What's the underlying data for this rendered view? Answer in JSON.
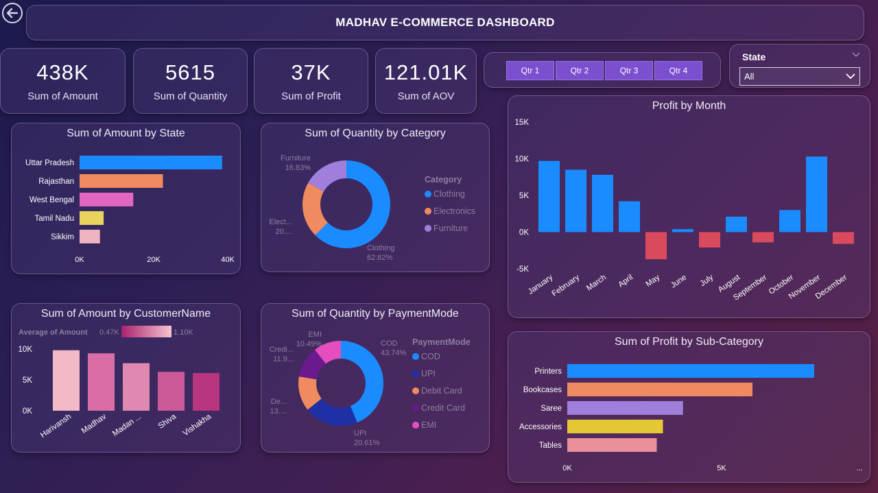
{
  "header": {
    "title": "MADHAV E-COMMERCE DASHBOARD"
  },
  "kpis": [
    {
      "value": "438K",
      "label": "Sum of Amount"
    },
    {
      "value": "5615",
      "label": "Sum of Quantity"
    },
    {
      "value": "37K",
      "label": "Sum of Profit"
    },
    {
      "value": "121.01K",
      "label": "Sum of AOV"
    }
  ],
  "quarters": [
    "Qtr 1",
    "Qtr 2",
    "Qtr 3",
    "Qtr 4"
  ],
  "state_slicer": {
    "label": "State",
    "value": "All"
  },
  "colors": {
    "blue": "#1a8cff",
    "orange": "#ef8b5e",
    "pink": "#e066c2",
    "yellow": "#e8d45c",
    "lightpink": "#f0b3c2",
    "negative": "#d94a5c",
    "purple": "#9f7fdb",
    "navy": "#1f30a6",
    "darkpurple": "#6a1a8c",
    "magenta": "#e64dbf"
  },
  "chart_data": [
    {
      "id": "amount_by_state",
      "type": "bar",
      "orientation": "horizontal",
      "title": "Sum of Amount by State",
      "categories": [
        "Uttar Pradesh",
        "Rajasthan",
        "West Bengal",
        "Tamil Nadu",
        "Sikkim"
      ],
      "values": [
        38500,
        22500,
        14500,
        6500,
        5500
      ],
      "xlim": [
        0,
        40000
      ],
      "ticks": [
        0,
        20000,
        40000
      ],
      "tick_labels": [
        "0K",
        "20K",
        "40K"
      ]
    },
    {
      "id": "quantity_by_category",
      "type": "pie",
      "donut": true,
      "title": "Sum of Quantity by Category",
      "legend_title": "Category",
      "slices": [
        {
          "label": "Clothing",
          "value": 62.62,
          "pct_label": "62.62%"
        },
        {
          "label": "Electronics",
          "value": 20.55,
          "pct_label": "20...."
        },
        {
          "label": "Furniture",
          "value": 16.83,
          "pct_label": "16.83%"
        }
      ],
      "callout_labels": [
        "Clothing",
        "Elect...",
        "Furniture"
      ]
    },
    {
      "id": "profit_by_month",
      "type": "bar",
      "title": "Profit by Month",
      "categories": [
        "January",
        "February",
        "March",
        "April",
        "May",
        "June",
        "July",
        "August",
        "September",
        "October",
        "November",
        "December"
      ],
      "values": [
        9700,
        8500,
        7800,
        4200,
        -3700,
        400,
        -2100,
        2100,
        -1400,
        3000,
        10300,
        -1600
      ],
      "ylim": [
        -5000,
        15000
      ],
      "ticks": [
        -5000,
        0,
        5000,
        10000,
        15000
      ],
      "tick_labels": [
        "-5K",
        "0K",
        "5K",
        "10K",
        "15K"
      ]
    },
    {
      "id": "amount_by_customer",
      "type": "bar",
      "title": "Sum of Amount by CustomerName",
      "gradient_legend": {
        "label": "Average of Amount",
        "min": "0.47K",
        "max": "1.10K"
      },
      "categories": [
        "Harivansh",
        "Madhav",
        "Madan ...",
        "Shiva",
        "Vishakha"
      ],
      "values": [
        9800,
        9300,
        7700,
        6300,
        6100
      ],
      "ylim": [
        0,
        10000
      ],
      "ticks": [
        0,
        5000,
        10000
      ],
      "tick_labels": [
        "0K",
        "5K",
        "10K"
      ]
    },
    {
      "id": "quantity_by_paymentmode",
      "type": "pie",
      "donut": true,
      "title": "Sum of Quantity by PaymentMode",
      "legend_title": "PaymentMode",
      "slices": [
        {
          "label": "COD",
          "value": 43.74,
          "pct_label": "43.74%"
        },
        {
          "label": "UPI",
          "value": 20.61,
          "pct_label": "20.61%"
        },
        {
          "label": "Debit Card",
          "value": 13.2,
          "pct_label": "13...."
        },
        {
          "label": "Credit Card",
          "value": 11.96,
          "pct_label": "11.9..."
        },
        {
          "label": "EMI",
          "value": 10.49,
          "pct_label": "10.49%"
        }
      ],
      "callout_labels": [
        "COD",
        "UPI",
        "De...",
        "Credi...",
        "EMI"
      ]
    },
    {
      "id": "profit_by_subcategory",
      "type": "bar",
      "orientation": "horizontal",
      "title": "Sum of Profit by Sub-Category",
      "categories": [
        "Printers",
        "Bookcases",
        "Saree",
        "Accessories",
        "Tables"
      ],
      "values": [
        8000,
        6000,
        3750,
        3100,
        2900
      ],
      "xlim": [
        0,
        9000
      ],
      "ticks": [
        0,
        5000
      ],
      "tick_labels": [
        "0K",
        "5K"
      ],
      "overflow_label": "..."
    }
  ]
}
